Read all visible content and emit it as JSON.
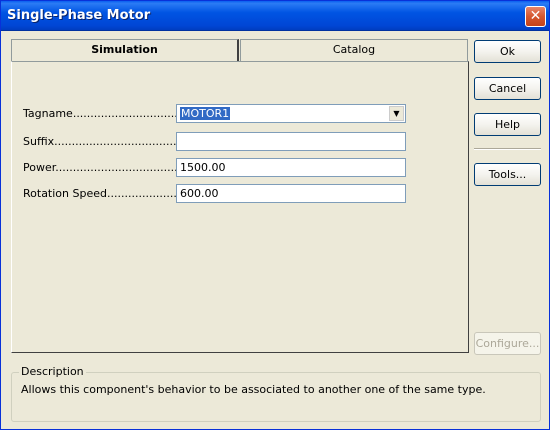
{
  "window": {
    "title": "Single-Phase Motor",
    "close_glyph": "✕"
  },
  "tabs": [
    {
      "label": "Simulation",
      "active": true
    },
    {
      "label": "Catalog",
      "active": false
    }
  ],
  "fields": {
    "tagname": {
      "label": "Tagname......................................",
      "value": "MOTOR1"
    },
    "suffix": {
      "label": "Suffix...........................................",
      "value": ""
    },
    "power": {
      "label": "Power..............................................",
      "value": "1500.00"
    },
    "rotation_speed": {
      "label": "Rotation Speed........................",
      "value": "600.00"
    }
  },
  "buttons": {
    "ok": "Ok",
    "cancel": "Cancel",
    "help": "Help",
    "tools": "Tools...",
    "configure": "Configure..."
  },
  "description": {
    "legend": "Description",
    "text": "Allows this component's behavior to be associated to another one of the same type."
  },
  "icons": {
    "combo_arrow": "chevron-down-icon",
    "close": "close-icon"
  },
  "colors": {
    "titlebar": "#0054e3",
    "selection": "#316ac5",
    "close_button": "#d5572f"
  }
}
